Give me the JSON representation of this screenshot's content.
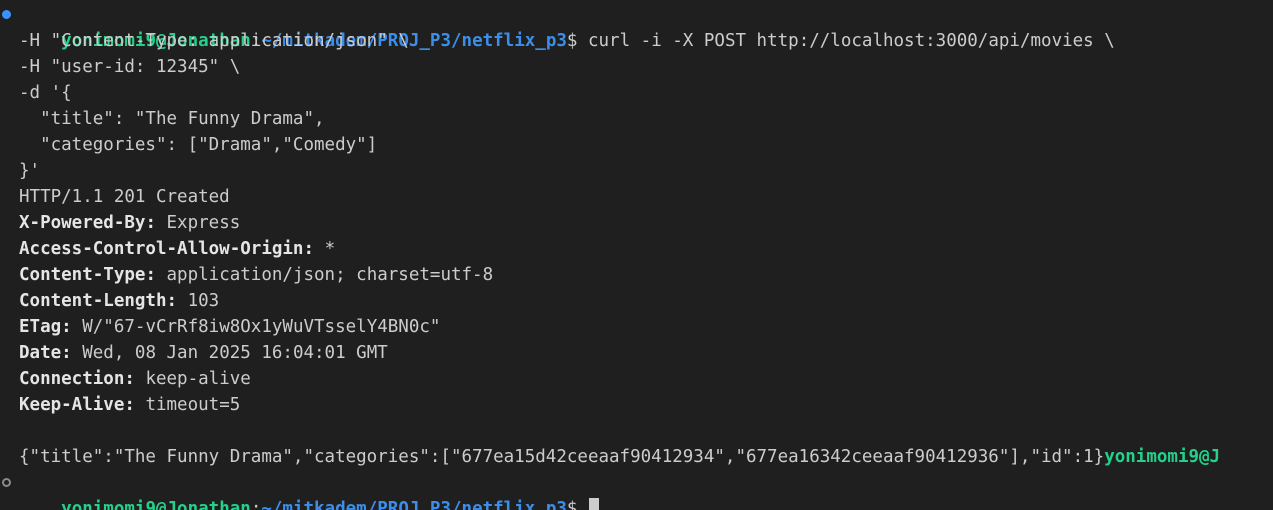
{
  "prompt": {
    "user_host": "yonimomi9@Jonathan",
    "separator": ":",
    "path": "~/mitkadem/PROJ_P3/netflix_p3",
    "symbol": "$ "
  },
  "command": {
    "line1": "curl -i -X POST http://localhost:3000/api/movies \\",
    "line2": "-H \"Content-Type: application/json\" \\",
    "line3": "-H \"user-id: 12345\" \\",
    "line4": "-d '{",
    "line5": "  \"title\": \"The Funny Drama\",",
    "line6": "  \"categories\": [\"Drama\",\"Comedy\"]",
    "line7": "}'"
  },
  "response": {
    "status_line": "HTTP/1.1 201 Created",
    "headers": [
      {
        "name": "X-Powered-By",
        "value": "Express"
      },
      {
        "name": "Access-Control-Allow-Origin",
        "value": "*"
      },
      {
        "name": "Content-Type",
        "value": "application/json; charset=utf-8"
      },
      {
        "name": "Content-Length",
        "value": "103"
      },
      {
        "name": "ETag",
        "value": "W/\"67-vCrRf8iw8Ox1yWuVTsselY4BN0c\""
      },
      {
        "name": "Date",
        "value": "Wed, 08 Jan 2025 16:04:01 GMT"
      },
      {
        "name": "Connection",
        "value": "keep-alive"
      },
      {
        "name": "Keep-Alive",
        "value": "timeout=5"
      }
    ],
    "header_colon": ": ",
    "body": "{\"title\":\"The Funny Drama\",\"categories\":[\"677ea15d42ceeaaf90412934\",\"677ea16342ceeaaf90412936\"],\"id\":1}",
    "body_trailing_prompt": "yonimomi9@J"
  },
  "colors": {
    "background": "#1f1f1f",
    "prompt_user": "#23d18b",
    "prompt_path": "#3b8eea",
    "text": "#cccccc",
    "status_dot_active": "#3794ff",
    "status_dot_idle": "#8b8b8b"
  }
}
